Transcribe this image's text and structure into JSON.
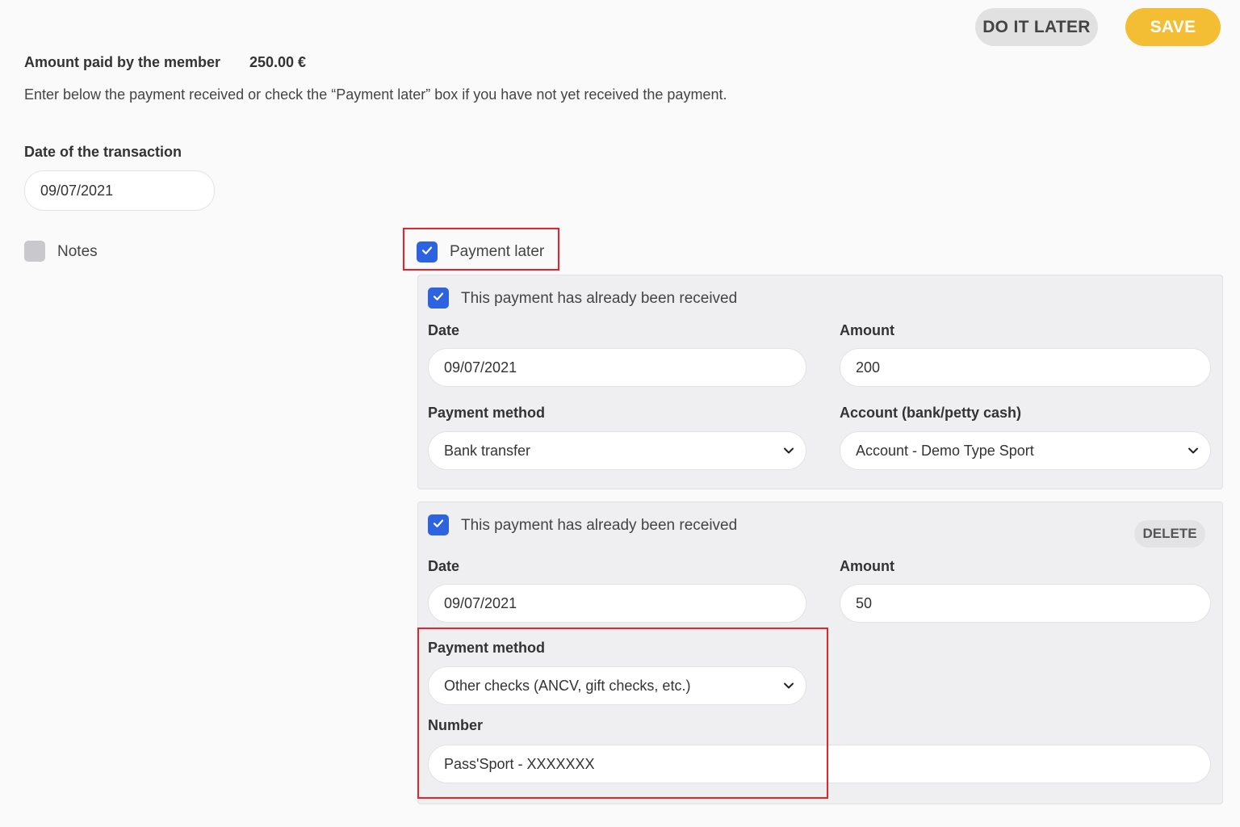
{
  "header": {
    "do_it_later": "DO IT LATER",
    "save": "SAVE"
  },
  "summary": {
    "amount_label": "Amount paid by the member",
    "amount_value": "250.00 €",
    "instructions": "Enter below the payment received or check the “Payment later” box if you have not yet received the payment."
  },
  "transaction": {
    "date_label": "Date of the transaction",
    "date_value": "09/07/2021"
  },
  "notes": {
    "label": "Notes",
    "checked": false
  },
  "payment_later": {
    "label": "Payment later",
    "checked": true
  },
  "payments": [
    {
      "received_label": "This payment has already been received",
      "received": true,
      "date_label": "Date",
      "date_value": "09/07/2021",
      "amount_label": "Amount",
      "amount_value": "200",
      "method_label": "Payment method",
      "method_value": "Bank transfer",
      "account_label": "Account (bank/petty cash)",
      "account_value": "Account - Demo Type Sport"
    },
    {
      "received_label": "This payment has already been received",
      "received": true,
      "delete_label": "DELETE",
      "date_label": "Date",
      "date_value": "09/07/2021",
      "amount_label": "Amount",
      "amount_value": "50",
      "method_label": "Payment method",
      "method_value": "Other checks (ANCV, gift checks, etc.)",
      "number_label": "Number",
      "number_value": "Pass'Sport - XXXXXXX"
    }
  ],
  "colors": {
    "accent": "#f3be33",
    "checkbox": "#2d63e0",
    "highlight": "#e8222b"
  }
}
